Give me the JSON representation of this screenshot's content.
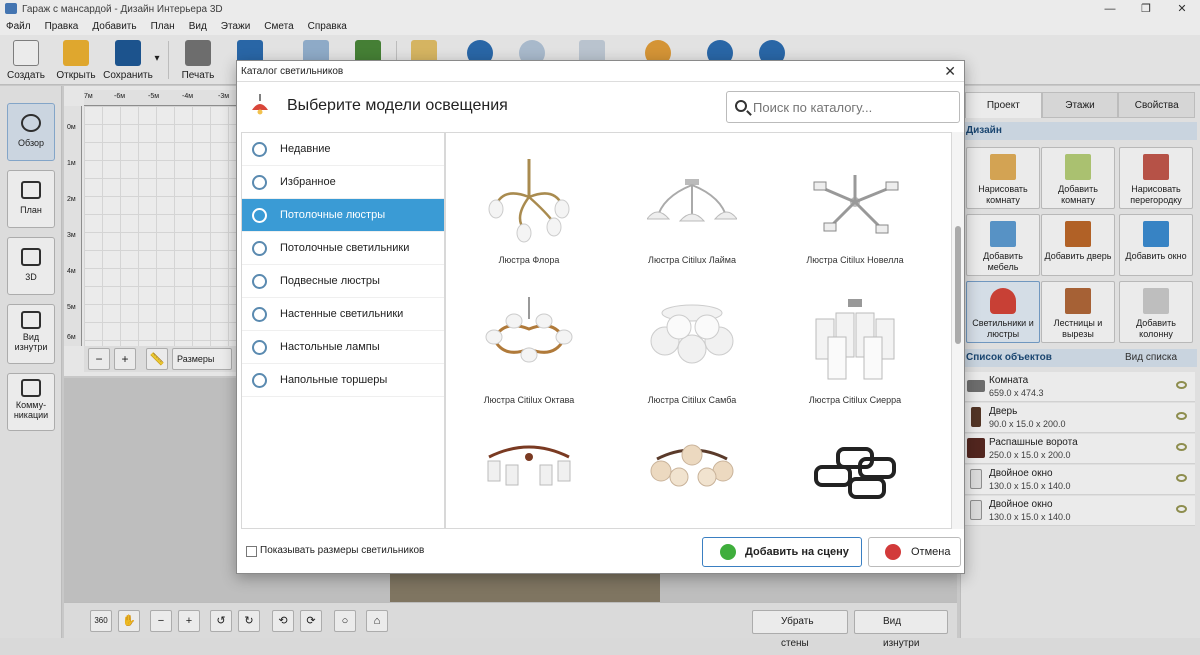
{
  "window": {
    "title": "Гараж с мансардой - Дизайн Интерьера 3D",
    "min": "—",
    "max": "❐",
    "close": "✕"
  },
  "menu": [
    "Файл",
    "Правка",
    "Добавить",
    "План",
    "Вид",
    "Этажи",
    "Смета",
    "Справка"
  ],
  "toolbar": {
    "create": "Создать",
    "open": "Открыть",
    "save": "Сохранить",
    "print": "Печать",
    "more": "▾"
  },
  "leftnav": [
    {
      "label": "Обзор",
      "icon": "eye-icon"
    },
    {
      "label": "План",
      "icon": "plan-icon"
    },
    {
      "label": "3D",
      "icon": "cube-icon"
    },
    {
      "label": "Вид изнутри",
      "icon": "interior-view-icon"
    },
    {
      "label": "Комму-никации",
      "icon": "pipes-icon"
    }
  ],
  "ruler": {
    "h": [
      "7м",
      "-6м",
      "-5м",
      "-4м",
      "-3м"
    ],
    "v": [
      "0м",
      "1м",
      "2м",
      "3м",
      "4м",
      "5м",
      "6м"
    ]
  },
  "zoom": {
    "sizes_label": "Размеры"
  },
  "bottom": {
    "remove_walls": "Убрать стены",
    "inside_view": "Вид изнутри"
  },
  "right": {
    "tabs": [
      "Проект",
      "Этажи",
      "Свойства"
    ],
    "design_header": "Дизайн",
    "design_buttons": [
      {
        "label": "Нарисовать комнату",
        "icon": "brush-icon"
      },
      {
        "label": "Добавить комнату",
        "icon": "add-room-icon"
      },
      {
        "label": "Нарисовать перегородку",
        "icon": "brick-wall-icon"
      },
      {
        "label": "Добавить мебель",
        "icon": "armchair-icon"
      },
      {
        "label": "Добавить дверь",
        "icon": "door-icon"
      },
      {
        "label": "Добавить окно",
        "icon": "window-icon"
      },
      {
        "label": "Светильники и люстры",
        "icon": "lamp-icon"
      },
      {
        "label": "Лестницы и вырезы",
        "icon": "stairs-icon"
      },
      {
        "label": "Добавить колонну",
        "icon": "column-icon"
      }
    ],
    "objects_header": "Список объектов",
    "objects_view": "Вид списка",
    "objects": [
      {
        "name": "Комната",
        "dims": "659.0 x 474.3"
      },
      {
        "name": "Дверь",
        "dims": "90.0 x 15.0 x 200.0"
      },
      {
        "name": "Распашные ворота",
        "dims": "250.0 x 15.0 x 200.0"
      },
      {
        "name": "Двойное окно",
        "dims": "130.0 x 15.0 x 140.0"
      },
      {
        "name": "Двойное окно",
        "dims": "130.0 x 15.0 x 140.0"
      }
    ]
  },
  "dialog": {
    "title": "Каталог светильников",
    "heading": "Выберите модели освещения",
    "search_placeholder": "Поиск по каталогу...",
    "close": "✕",
    "categories": [
      {
        "label": "Недавние",
        "icon": "clock-icon"
      },
      {
        "label": "Избранное",
        "icon": "heart-icon"
      },
      {
        "label": "Потолочные люстры",
        "icon": "chandelier-icon",
        "active": true
      },
      {
        "label": "Потолочные светильники",
        "icon": "ceiling-light-icon"
      },
      {
        "label": "Подвесные люстры",
        "icon": "pendant-icon"
      },
      {
        "label": "Настенные светильники",
        "icon": "wall-light-icon"
      },
      {
        "label": "Настольные лампы",
        "icon": "desk-lamp-icon"
      },
      {
        "label": "Напольные торшеры",
        "icon": "floor-lamp-icon"
      }
    ],
    "items": [
      "Люстра Флора",
      "Люстра Citilux Лайма",
      "Люстра Citilux Новелла",
      "Люстра Citilux Октава",
      "Люстра Citilux Самба",
      "Люстра Citilux Сиерра",
      "",
      "",
      ""
    ],
    "show_sizes": "Показывать размеры светильников",
    "add": "Добавить на сцену",
    "cancel": "Отмена"
  },
  "colors": {
    "accent": "#3a9bd5",
    "ok": "#3fae3c",
    "cancel": "#d23a3a"
  }
}
